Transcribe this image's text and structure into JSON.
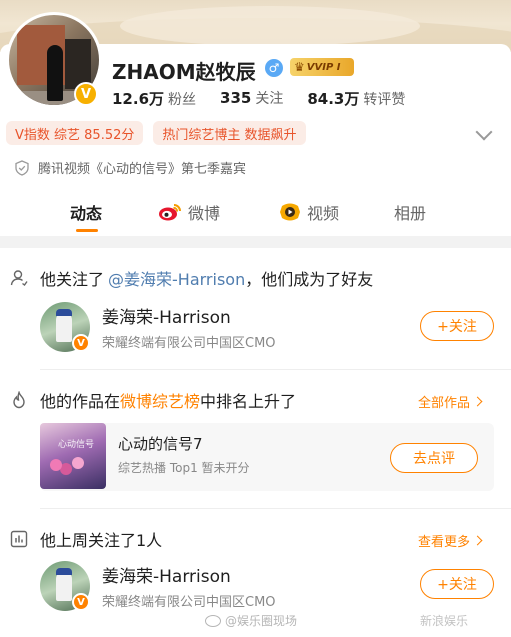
{
  "profile": {
    "name": "ZHAOM赵牧辰",
    "gender_symbol": "♂",
    "vip_label": "VVIP I",
    "verified_mark": "V",
    "stats": [
      {
        "value": "12.6万",
        "label": "粉丝"
      },
      {
        "value": "335",
        "label": "关注"
      },
      {
        "value": "84.3万",
        "label": "转评赞"
      }
    ],
    "tags": [
      "V指数 综艺 85.52分",
      "热门综艺博主 数据飙升"
    ],
    "certification": "腾讯视频《心动的信号》第七季嘉宾"
  },
  "tabs": [
    {
      "label": "动态",
      "active": true,
      "icon": ""
    },
    {
      "label": "微博",
      "active": false,
      "icon": "weibo-icon"
    },
    {
      "label": "视频",
      "active": false,
      "icon": "video-icon"
    },
    {
      "label": "相册",
      "active": false,
      "icon": ""
    }
  ],
  "feed": {
    "follow_event": {
      "prefix": "他关注了",
      "mention": "@姜海荣-Harrison",
      "suffix": "，他们成为了好友",
      "user": {
        "name": "姜海荣-Harrison",
        "desc": "荣耀终端有限公司中国区CMO"
      },
      "follow_label": "+关注"
    },
    "rank_event": {
      "prefix": "他的作品在",
      "link": "微博综艺榜",
      "suffix": "中排名上升了",
      "more_label": "全部作品",
      "work": {
        "title": "心动的信号7",
        "subtitle": "综艺热播 Top1 暂未开分",
        "cover_text": "心动信号"
      },
      "review_label": "去点评"
    },
    "weekly_follow": {
      "title": "他上周关注了1人",
      "more_label": "查看更多",
      "user": {
        "name": "姜海荣-Harrison",
        "desc": "荣耀终端有限公司中国区CMO"
      },
      "follow_label": "+关注"
    }
  },
  "watermark": {
    "left": "@娱乐圈现场",
    "right": "新浪娱乐"
  },
  "colors": {
    "accent": "#ff8200",
    "link": "#507daf",
    "tag_bg": "#fbece6",
    "tag_text": "#e8542b",
    "verified": "#f7b000"
  }
}
